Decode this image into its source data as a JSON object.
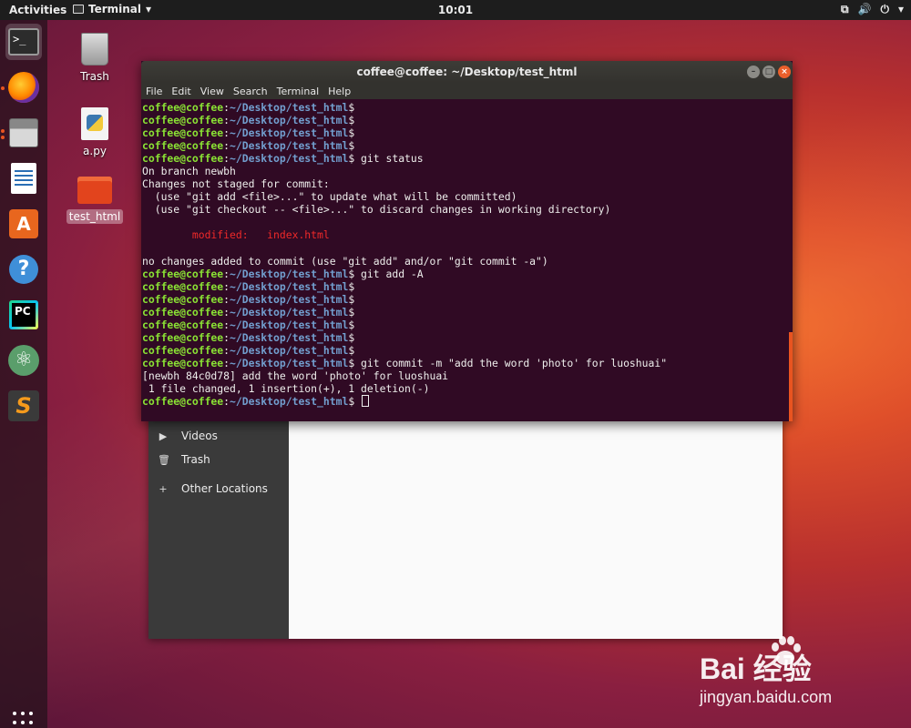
{
  "topbar": {
    "activities": "Activities",
    "app_name": "Terminal",
    "app_arrow": "▾",
    "clock": "10:01",
    "tray_network": "⧉",
    "tray_volume": "🔊",
    "tray_power": "⏻",
    "tray_arrow": "▾"
  },
  "dock": {
    "items": [
      "terminal",
      "firefox",
      "files",
      "libreoffice-writer",
      "ubuntu-software",
      "help",
      "pycharm",
      "atom",
      "sublime-text"
    ],
    "pc_label": "PC",
    "sublime_label": "S",
    "store_label": "A",
    "help_label": "?",
    "term_label": ">_"
  },
  "desktop": {
    "icons": [
      {
        "label": "Trash"
      },
      {
        "label": "a.py"
      },
      {
        "label": "test_html"
      }
    ]
  },
  "files_window": {
    "sidebar": [
      {
        "icon": "▶",
        "label": "Videos"
      },
      {
        "icon": "🗑",
        "label": "Trash"
      },
      {
        "icon": "+",
        "label": "Other Locations"
      }
    ]
  },
  "terminal": {
    "title": "coffee@coffee: ~/Desktop/test_html",
    "menu": [
      "File",
      "Edit",
      "View",
      "Search",
      "Terminal",
      "Help"
    ],
    "user_host": "coffee@coffee",
    "path": "~/Desktop/test_html",
    "lines": [
      {
        "type": "prompt",
        "cmd": ""
      },
      {
        "type": "prompt",
        "cmd": ""
      },
      {
        "type": "prompt",
        "cmd": ""
      },
      {
        "type": "prompt",
        "cmd": ""
      },
      {
        "type": "prompt",
        "cmd": " git status"
      },
      {
        "type": "text",
        "text": "On branch newbh"
      },
      {
        "type": "text",
        "text": "Changes not staged for commit:"
      },
      {
        "type": "text",
        "text": "  (use \"git add <file>...\" to update what will be committed)"
      },
      {
        "type": "text",
        "text": "  (use \"git checkout -- <file>...\" to discard changes in working directory)"
      },
      {
        "type": "text",
        "text": ""
      },
      {
        "type": "red",
        "text": "        modified:   index.html"
      },
      {
        "type": "text",
        "text": ""
      },
      {
        "type": "text",
        "text": "no changes added to commit (use \"git add\" and/or \"git commit -a\")"
      },
      {
        "type": "prompt",
        "cmd": " git add -A"
      },
      {
        "type": "prompt",
        "cmd": ""
      },
      {
        "type": "prompt",
        "cmd": ""
      },
      {
        "type": "prompt",
        "cmd": ""
      },
      {
        "type": "prompt",
        "cmd": ""
      },
      {
        "type": "prompt",
        "cmd": ""
      },
      {
        "type": "prompt",
        "cmd": ""
      },
      {
        "type": "prompt",
        "cmd": " git commit -m \"add the word 'photo' for luoshuai\""
      },
      {
        "type": "text",
        "text": "[newbh 84c0d78] add the word 'photo' for luoshuai"
      },
      {
        "type": "text",
        "text": " 1 file changed, 1 insertion(+), 1 deletion(-)"
      },
      {
        "type": "prompt",
        "cmd": " ",
        "cursor": true
      }
    ]
  },
  "watermark": {
    "logo": "Bai  经验",
    "url": "jingyan.baidu.com"
  }
}
